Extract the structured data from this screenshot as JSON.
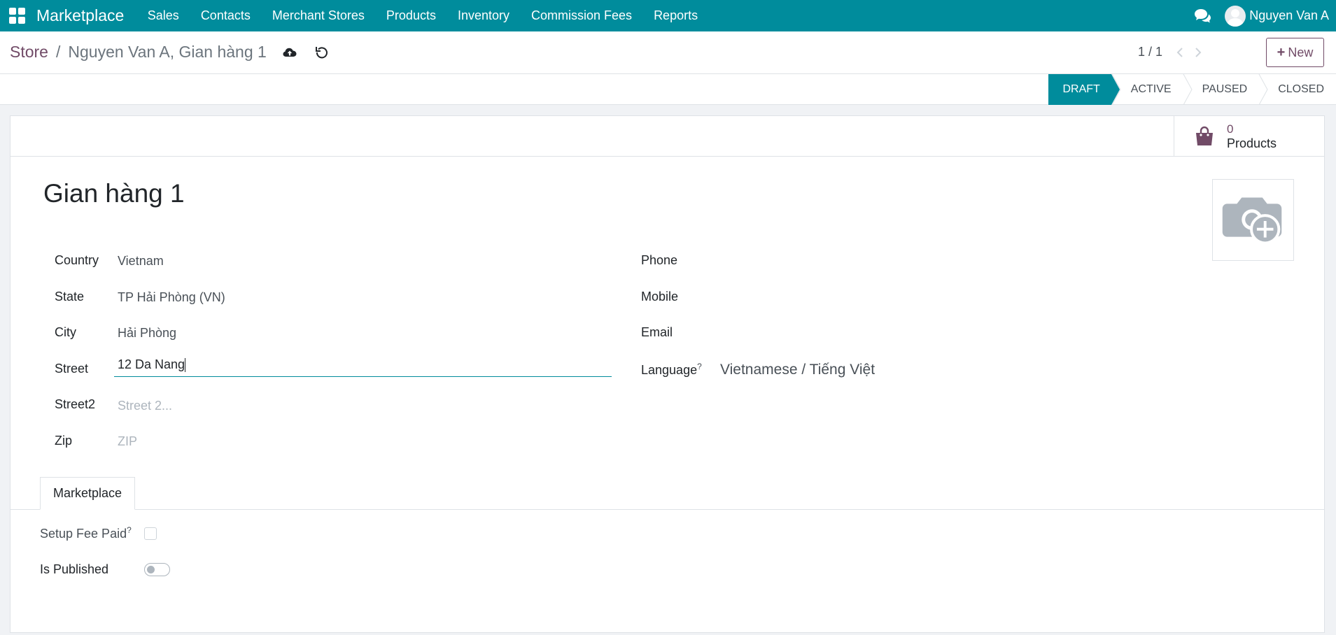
{
  "navbar": {
    "brand": "Marketplace",
    "menu": [
      "Sales",
      "Contacts",
      "Merchant Stores",
      "Products",
      "Inventory",
      "Commission Fees",
      "Reports"
    ],
    "user": "Nguyen Van A"
  },
  "control": {
    "breadcrumb_parent": "Store",
    "breadcrumb_separator": "/",
    "breadcrumb_current": "Nguyen Van A, Gian hàng 1",
    "pager": "1 / 1",
    "new_label": "New",
    "new_plus": "+"
  },
  "status": {
    "stages": [
      "DRAFT",
      "ACTIVE",
      "PAUSED",
      "CLOSED"
    ],
    "current": "DRAFT"
  },
  "stat": {
    "value": "0",
    "label": "Products"
  },
  "form": {
    "title": "Gian hàng 1",
    "left_labels": {
      "country": "Country",
      "state": "State",
      "city": "City",
      "street": "Street",
      "street2": "Street2",
      "zip": "Zip"
    },
    "values": {
      "country": "Vietnam",
      "state": "TP Hải Phòng (VN)",
      "city": "Hải Phòng",
      "street": "12 Da Nang",
      "street2_placeholder": "Street 2...",
      "zip_placeholder": "ZIP"
    },
    "right_labels": {
      "phone": "Phone",
      "mobile": "Mobile",
      "email": "Email",
      "language": "Language"
    },
    "language_value": "Vietnamese / Tiếng Việt",
    "help_mark": "?"
  },
  "notebook": {
    "tab": "Marketplace",
    "setup_fee_label": "Setup Fee Paid",
    "setup_fee_paid": false,
    "published_label": "Is Published",
    "is_published": false
  },
  "colors": {
    "primary": "#008c9c",
    "accent": "#714b67"
  }
}
